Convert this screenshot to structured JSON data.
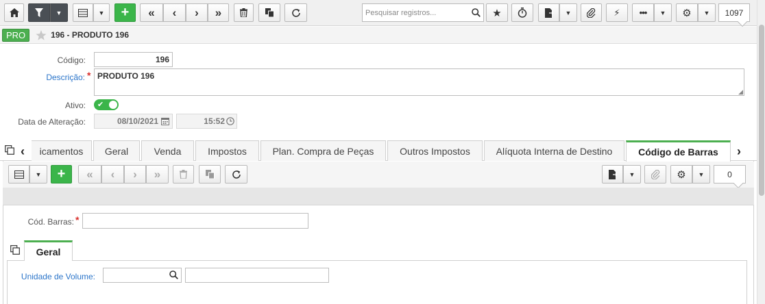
{
  "toolbar": {
    "search_placeholder": "Pesquisar registros...",
    "record_count": "1097"
  },
  "title": {
    "badge": "PRO",
    "text": "196 - PRODUTO 196"
  },
  "form": {
    "codigo_label": "Código:",
    "codigo_value": "196",
    "descricao_label": "Descrição:",
    "descricao_value": "PRODUTO 196",
    "ativo_label": "Ativo:",
    "ativo_checked": true,
    "data_label": "Data de Alteração:",
    "data_value": "08/10/2021",
    "hora_value": "15:52"
  },
  "tabs": [
    {
      "label": "icamentos"
    },
    {
      "label": "Geral"
    },
    {
      "label": "Venda"
    },
    {
      "label": "Impostos"
    },
    {
      "label": "Plan. Compra de Peças"
    },
    {
      "label": "Outros Impostos"
    },
    {
      "label": "Alíquota Interna de Destino"
    },
    {
      "label": "Código de Barras"
    }
  ],
  "active_tab": "Código de Barras",
  "sub": {
    "record_count": "0",
    "cod_barras_label": "Cód. Barras:",
    "cod_barras_value": "",
    "subtab_label": "Geral",
    "unidade_label": "Unidade de Volume:",
    "unidade_code": "",
    "unidade_desc": ""
  },
  "colors": {
    "accent_green": "#3bb54a",
    "required_label": "#2a74c9",
    "required_star": "#d9302c"
  }
}
